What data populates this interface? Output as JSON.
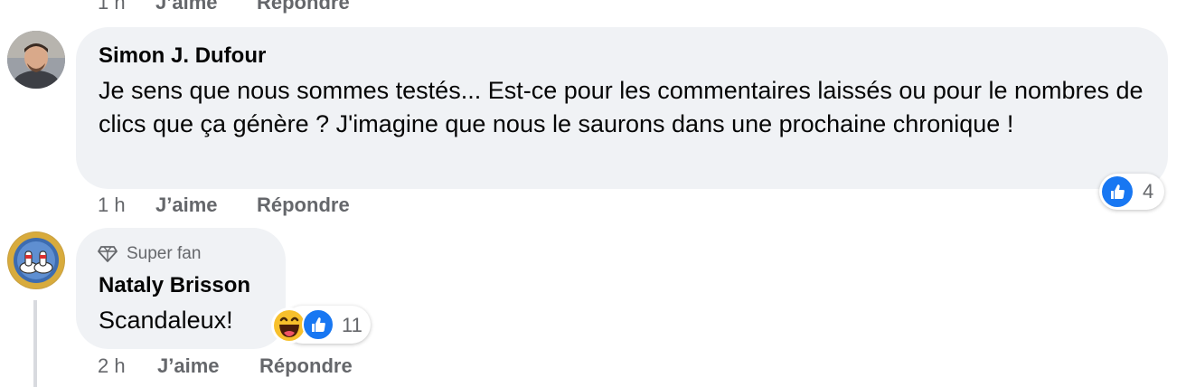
{
  "top_comment": {
    "time": "1 h",
    "like_label": "J’aime",
    "reply_label": "Répondre"
  },
  "comment1": {
    "author": "Simon J. Dufour",
    "text": "Je sens que nous sommes testés... Est-ce pour les commentaires laissés ou pour le nombres de clics que ça génère ? J'imagine que nous le saurons dans une prochaine chronique !",
    "reactions": {
      "icons": [
        "like-icon"
      ],
      "count": "4"
    },
    "time": "1 h",
    "like_label": "J’aime",
    "reply_label": "Répondre"
  },
  "comment2": {
    "badge": "Super fan",
    "badge_icon": "diamond-icon",
    "author": "Nataly Brisson",
    "text": "Scandaleux!",
    "reactions": {
      "icons": [
        "haha-icon",
        "like-icon"
      ],
      "count": "11"
    },
    "time": "2 h",
    "like_label": "J’aime",
    "reply_label": "Répondre"
  },
  "colors": {
    "bubble": "#f0f2f5",
    "like_blue": "#1877f2",
    "meta_gray": "#65676b",
    "haha_yellow": "#f7c02c"
  }
}
